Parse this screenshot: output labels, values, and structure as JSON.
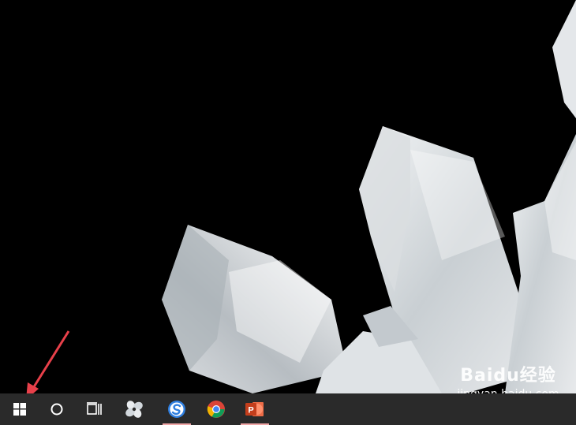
{
  "colors": {
    "taskbar": "#2a2a2a",
    "wallpaper_bg": "#000000",
    "annotation_arrow": "#e8404a",
    "active_indicator": "#f1a7a7"
  },
  "taskbar": {
    "items": [
      {
        "icon": "windows-start-icon"
      },
      {
        "icon": "cortana-search-icon"
      },
      {
        "icon": "task-view-icon"
      },
      {
        "icon": "pinwheel-app-icon"
      },
      {
        "icon": "sogou-browser-icon"
      },
      {
        "icon": "chrome-icon"
      },
      {
        "icon": "powerpoint-icon",
        "glyph": "P"
      }
    ]
  },
  "watermark": {
    "brand": "Baidu经验",
    "site": "jingyan.baidu.com"
  }
}
